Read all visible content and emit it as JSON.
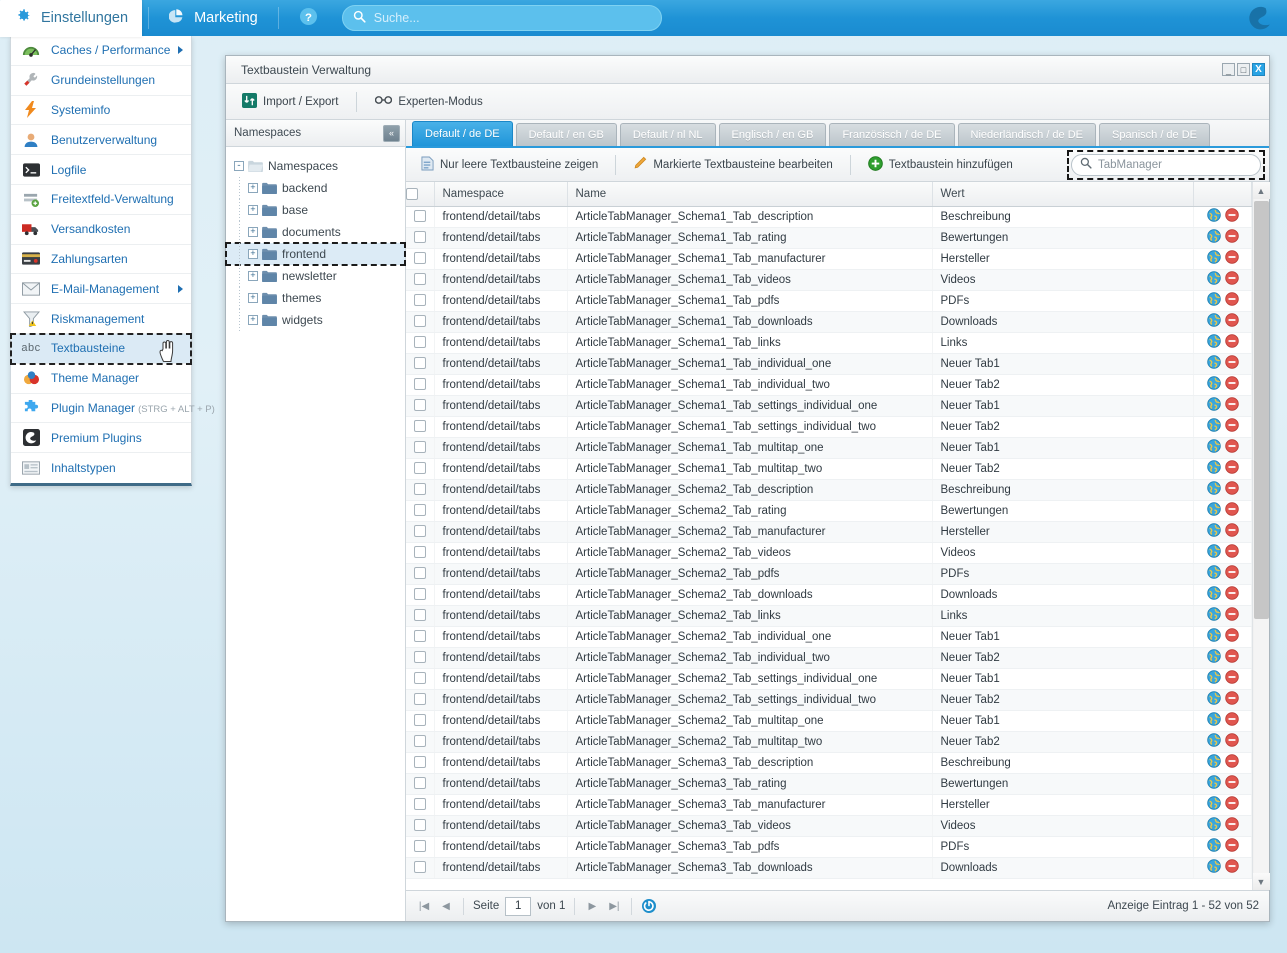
{
  "topbar": {
    "active_nav": "Einstellungen",
    "nav_items": [
      {
        "label": "Einstellungen",
        "icon": "gear-icon",
        "active": true
      },
      {
        "label": "Marketing",
        "icon": "pie-chart-icon",
        "active": false
      }
    ],
    "help_icon": "help-icon",
    "search": {
      "value": "",
      "placeholder": "Suche..."
    },
    "logo": "shopware-logo"
  },
  "menu": {
    "items": [
      {
        "label": "Caches / Performance",
        "icon": "gauge-icon",
        "has_submenu": true
      },
      {
        "label": "Grundeinstellungen",
        "icon": "wrench-icon",
        "has_submenu": false
      },
      {
        "label": "Systeminfo",
        "icon": "lightning-icon",
        "has_submenu": false
      },
      {
        "label": "Benutzerverwaltung",
        "icon": "user-icon",
        "has_submenu": false
      },
      {
        "label": "Logfile",
        "icon": "terminal-icon",
        "has_submenu": false
      },
      {
        "label": "Freitextfeld-Verwaltung",
        "icon": "form-add-icon",
        "has_submenu": false
      },
      {
        "label": "Versandkosten",
        "icon": "truck-icon",
        "has_submenu": false
      },
      {
        "label": "Zahlungsarten",
        "icon": "creditcard-icon",
        "has_submenu": false
      },
      {
        "label": "E-Mail-Management",
        "icon": "envelope-icon",
        "has_submenu": true
      },
      {
        "label": "Riskmanagement",
        "icon": "funnel-warning-icon",
        "has_submenu": false
      },
      {
        "label": "Textbausteine",
        "icon": "abc-icon",
        "has_submenu": false,
        "selected": true
      },
      {
        "label": "Theme Manager",
        "icon": "palette-icon",
        "has_submenu": false
      },
      {
        "label": "Plugin Manager",
        "hint": "(STRG + ALT + P)",
        "icon": "plugin-icon",
        "has_submenu": false
      },
      {
        "label": "Premium Plugins",
        "icon": "shopware-badge-icon",
        "has_submenu": false
      },
      {
        "label": "Inhaltstypen",
        "icon": "content-icon",
        "has_submenu": false
      }
    ]
  },
  "window": {
    "title": "Textbaustein Verwaltung",
    "controls": {
      "minimize": "_",
      "maximize": "□",
      "close": "X"
    },
    "toolbar": [
      {
        "label": "Import / Export",
        "icon": "import-export-icon"
      },
      {
        "label": "Experten-Modus",
        "icon": "glasses-icon"
      }
    ]
  },
  "namespaces": {
    "header": "Namespaces",
    "collapse_label": "«",
    "root": {
      "label": "Namespaces",
      "expander": "-"
    },
    "children": [
      {
        "label": "backend",
        "expander": "+"
      },
      {
        "label": "base",
        "expander": "+"
      },
      {
        "label": "documents",
        "expander": "+"
      },
      {
        "label": "frontend",
        "expander": "+",
        "selected": true
      },
      {
        "label": "newsletter",
        "expander": "+"
      },
      {
        "label": "themes",
        "expander": "+"
      },
      {
        "label": "widgets",
        "expander": "+"
      }
    ]
  },
  "tabs": [
    {
      "label": "Default / de  DE",
      "active": true
    },
    {
      "label": "Default / en  GB",
      "active": false
    },
    {
      "label": "Default / nl  NL",
      "active": false
    },
    {
      "label": "Englisch / en  GB",
      "active": false
    },
    {
      "label": "Französisch / de  DE",
      "active": false
    },
    {
      "label": "Niederländisch / de  DE",
      "active": false
    },
    {
      "label": "Spanisch / de  DE",
      "active": false
    }
  ],
  "grid_toolbar": {
    "buttons": [
      {
        "label": "Nur leere Textbausteine zeigen",
        "icon": "document-icon"
      },
      {
        "label": "Markierte Textbausteine bearbeiten",
        "icon": "pencil-icon"
      },
      {
        "label": "Textbaustein hinzufügen",
        "icon": "plus-circle-icon"
      }
    ],
    "search": {
      "value": "TabManager",
      "placeholder": "Suche",
      "icon": "search-icon"
    }
  },
  "grid": {
    "columns": [
      "",
      "Namespace",
      "Name",
      "Wert",
      ""
    ],
    "row_actions": [
      "globe-icon",
      "delete-icon"
    ],
    "rows": [
      [
        "frontend/detail/tabs",
        "ArticleTabManager_Schema1_Tab_description",
        "Beschreibung"
      ],
      [
        "frontend/detail/tabs",
        "ArticleTabManager_Schema1_Tab_rating",
        "Bewertungen"
      ],
      [
        "frontend/detail/tabs",
        "ArticleTabManager_Schema1_Tab_manufacturer",
        "Hersteller"
      ],
      [
        "frontend/detail/tabs",
        "ArticleTabManager_Schema1_Tab_videos",
        "Videos"
      ],
      [
        "frontend/detail/tabs",
        "ArticleTabManager_Schema1_Tab_pdfs",
        "PDFs"
      ],
      [
        "frontend/detail/tabs",
        "ArticleTabManager_Schema1_Tab_downloads",
        "Downloads"
      ],
      [
        "frontend/detail/tabs",
        "ArticleTabManager_Schema1_Tab_links",
        "Links"
      ],
      [
        "frontend/detail/tabs",
        "ArticleTabManager_Schema1_Tab_individual_one",
        "Neuer Tab1"
      ],
      [
        "frontend/detail/tabs",
        "ArticleTabManager_Schema1_Tab_individual_two",
        "Neuer Tab2"
      ],
      [
        "frontend/detail/tabs",
        "ArticleTabManager_Schema1_Tab_settings_individual_one",
        "Neuer Tab1"
      ],
      [
        "frontend/detail/tabs",
        "ArticleTabManager_Schema1_Tab_settings_individual_two",
        "Neuer Tab2"
      ],
      [
        "frontend/detail/tabs",
        "ArticleTabManager_Schema1_Tab_multitap_one",
        "Neuer Tab1"
      ],
      [
        "frontend/detail/tabs",
        "ArticleTabManager_Schema1_Tab_multitap_two",
        "Neuer Tab2"
      ],
      [
        "frontend/detail/tabs",
        "ArticleTabManager_Schema2_Tab_description",
        "Beschreibung"
      ],
      [
        "frontend/detail/tabs",
        "ArticleTabManager_Schema2_Tab_rating",
        "Bewertungen"
      ],
      [
        "frontend/detail/tabs",
        "ArticleTabManager_Schema2_Tab_manufacturer",
        "Hersteller"
      ],
      [
        "frontend/detail/tabs",
        "ArticleTabManager_Schema2_Tab_videos",
        "Videos"
      ],
      [
        "frontend/detail/tabs",
        "ArticleTabManager_Schema2_Tab_pdfs",
        "PDFs"
      ],
      [
        "frontend/detail/tabs",
        "ArticleTabManager_Schema2_Tab_downloads",
        "Downloads"
      ],
      [
        "frontend/detail/tabs",
        "ArticleTabManager_Schema2_Tab_links",
        "Links"
      ],
      [
        "frontend/detail/tabs",
        "ArticleTabManager_Schema2_Tab_individual_one",
        "Neuer Tab1"
      ],
      [
        "frontend/detail/tabs",
        "ArticleTabManager_Schema2_Tab_individual_two",
        "Neuer Tab2"
      ],
      [
        "frontend/detail/tabs",
        "ArticleTabManager_Schema2_Tab_settings_individual_one",
        "Neuer Tab1"
      ],
      [
        "frontend/detail/tabs",
        "ArticleTabManager_Schema2_Tab_settings_individual_two",
        "Neuer Tab2"
      ],
      [
        "frontend/detail/tabs",
        "ArticleTabManager_Schema2_Tab_multitap_one",
        "Neuer Tab1"
      ],
      [
        "frontend/detail/tabs",
        "ArticleTabManager_Schema2_Tab_multitap_two",
        "Neuer Tab2"
      ],
      [
        "frontend/detail/tabs",
        "ArticleTabManager_Schema3_Tab_description",
        "Beschreibung"
      ],
      [
        "frontend/detail/tabs",
        "ArticleTabManager_Schema3_Tab_rating",
        "Bewertungen"
      ],
      [
        "frontend/detail/tabs",
        "ArticleTabManager_Schema3_Tab_manufacturer",
        "Hersteller"
      ],
      [
        "frontend/detail/tabs",
        "ArticleTabManager_Schema3_Tab_videos",
        "Videos"
      ],
      [
        "frontend/detail/tabs",
        "ArticleTabManager_Schema3_Tab_pdfs",
        "PDFs"
      ],
      [
        "frontend/detail/tabs",
        "ArticleTabManager_Schema3_Tab_downloads",
        "Downloads"
      ]
    ]
  },
  "pager": {
    "first": "|◀",
    "prev": "◀",
    "page_label": "Seite",
    "page_value": "1",
    "of_label": "von 1",
    "next": "▶",
    "last": "▶|",
    "refresh": "refresh-icon",
    "status": "Anzeige Eintrag 1 - 52 von 52"
  }
}
